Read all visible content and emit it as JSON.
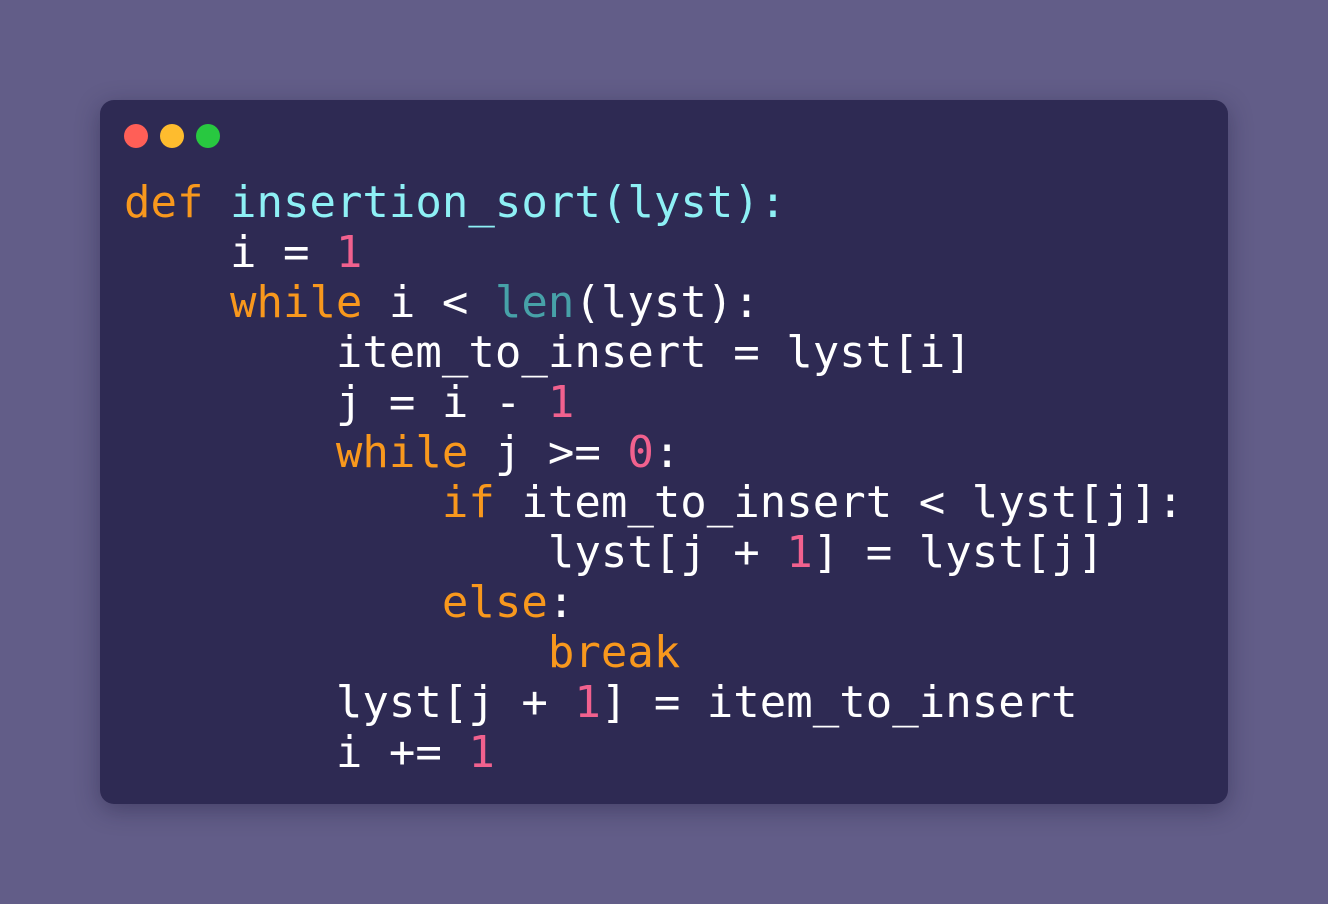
{
  "window": {
    "controls": [
      "close",
      "minimize",
      "zoom"
    ],
    "colors": {
      "background": "#2e2a53",
      "page_background": "#625d88",
      "close": "#ff5f57",
      "minimize": "#febc2e",
      "zoom": "#28c840"
    }
  },
  "syntax_colors": {
    "keyword": "#f8981d",
    "function_name": "#8ef0f5",
    "builtin": "#47a1a8",
    "number": "#f1618e",
    "text": "#ffffff"
  },
  "code": {
    "language": "python",
    "lines": [
      [
        {
          "t": "kw",
          "v": "def"
        },
        {
          "t": "txt",
          "v": " "
        },
        {
          "t": "fn",
          "v": "insertion_sort(lyst):"
        }
      ],
      [
        {
          "t": "txt",
          "v": "    i = "
        },
        {
          "t": "num",
          "v": "1"
        }
      ],
      [
        {
          "t": "txt",
          "v": "    "
        },
        {
          "t": "kw",
          "v": "while"
        },
        {
          "t": "txt",
          "v": " i < "
        },
        {
          "t": "bi",
          "v": "len"
        },
        {
          "t": "txt",
          "v": "(lyst):"
        }
      ],
      [
        {
          "t": "txt",
          "v": "        item_to_insert = lyst[i]"
        }
      ],
      [
        {
          "t": "txt",
          "v": "        j = i - "
        },
        {
          "t": "num",
          "v": "1"
        }
      ],
      [
        {
          "t": "txt",
          "v": "        "
        },
        {
          "t": "kw",
          "v": "while"
        },
        {
          "t": "txt",
          "v": " j >= "
        },
        {
          "t": "num",
          "v": "0"
        },
        {
          "t": "txt",
          "v": ":"
        }
      ],
      [
        {
          "t": "txt",
          "v": "            "
        },
        {
          "t": "kw",
          "v": "if"
        },
        {
          "t": "txt",
          "v": " item_to_insert < lyst[j]:"
        }
      ],
      [
        {
          "t": "txt",
          "v": "                lyst[j + "
        },
        {
          "t": "num",
          "v": "1"
        },
        {
          "t": "txt",
          "v": "] = lyst[j]"
        }
      ],
      [
        {
          "t": "txt",
          "v": "            "
        },
        {
          "t": "kw",
          "v": "else"
        },
        {
          "t": "txt",
          "v": ":"
        }
      ],
      [
        {
          "t": "txt",
          "v": "                "
        },
        {
          "t": "kw",
          "v": "break"
        }
      ],
      [
        {
          "t": "txt",
          "v": "        lyst[j + "
        },
        {
          "t": "num",
          "v": "1"
        },
        {
          "t": "txt",
          "v": "] = item_to_insert"
        }
      ],
      [
        {
          "t": "txt",
          "v": "        i += "
        },
        {
          "t": "num",
          "v": "1"
        }
      ]
    ]
  }
}
